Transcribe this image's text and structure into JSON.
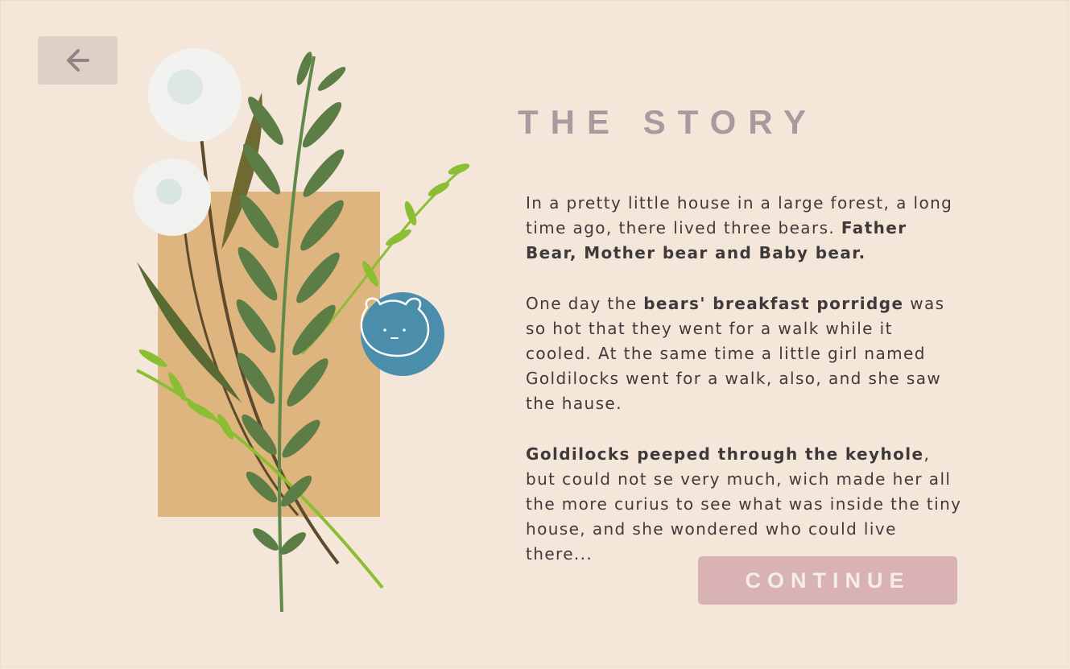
{
  "navigation": {
    "back_icon": "arrow-left-icon"
  },
  "page": {
    "title": "THE STORY"
  },
  "story": {
    "p1": {
      "text": "In a pretty little house in a large forest, a long time ago, there lived three bears. ",
      "bold": "Father Bear, Mother bear and Baby bear."
    },
    "p2": {
      "text1": "One day the ",
      "bold": "bears' breakfast porridge",
      "text2": " was so hot that they went for a walk while it cooled. At the same time a little girl named Goldilocks went for a walk, also, and she saw the hause."
    },
    "p3": {
      "bold": "Goldilocks peeped through the keyhole",
      "text": ", but could not se very much, wich made her all the more curius to see what was inside the tiny house, and she wondered who could live there..."
    }
  },
  "actions": {
    "continue_label": "CONTINUE"
  },
  "colors": {
    "background": "#f5e6da",
    "title": "#a89ba0",
    "continue_button": "#d9b3b3",
    "back_button": "#dfd0c6",
    "accent_blue": "#4a8eab",
    "tan_block": "#deb57f"
  }
}
